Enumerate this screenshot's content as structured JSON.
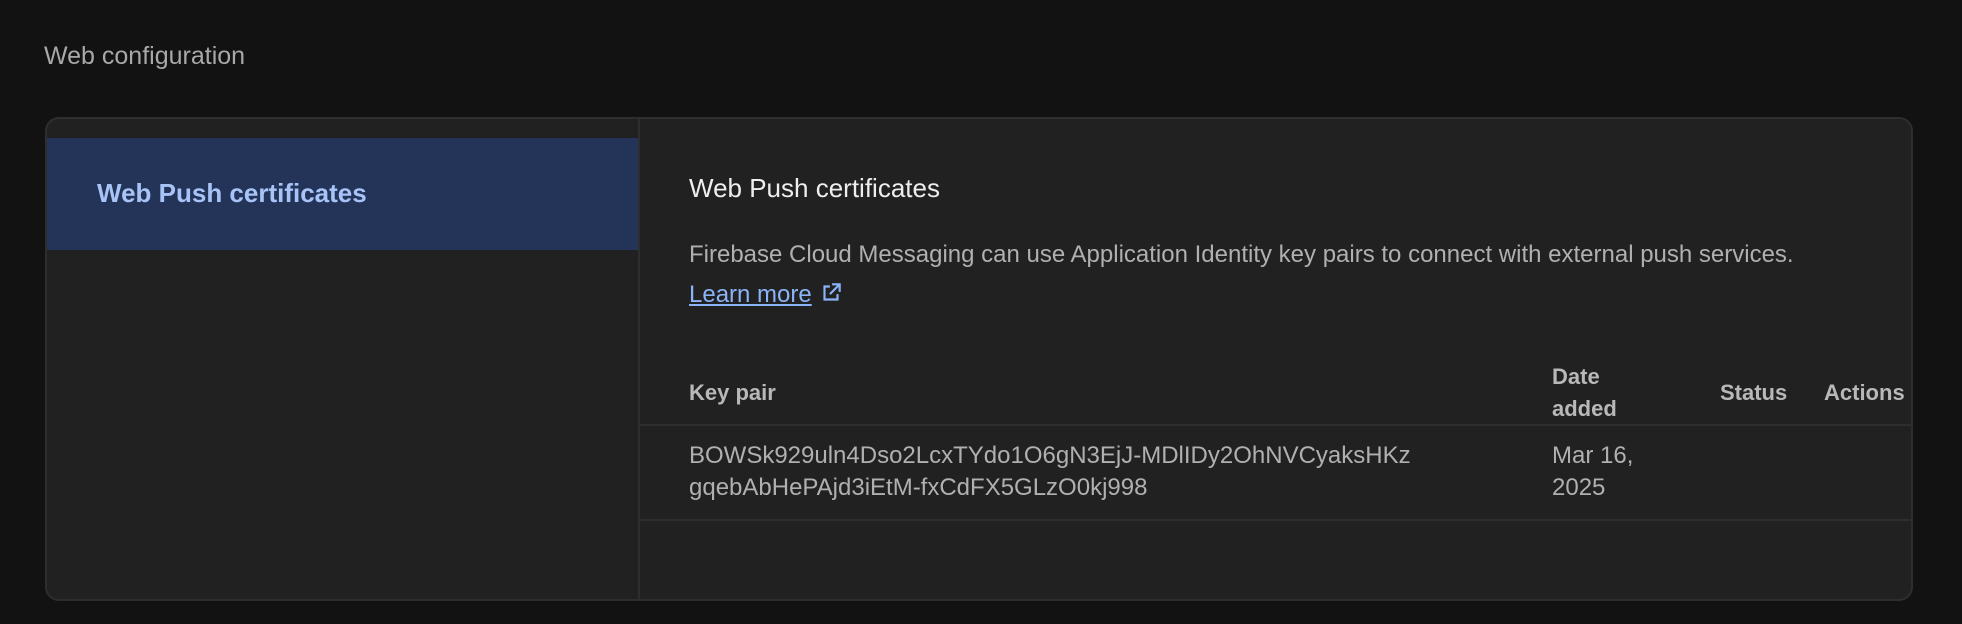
{
  "page": {
    "section_title": "Web configuration"
  },
  "sidebar": {
    "items": [
      {
        "label": "Web Push certificates"
      }
    ]
  },
  "content": {
    "title": "Web Push certificates",
    "description": "Firebase Cloud Messaging can use Application Identity key pairs to connect with external push services.",
    "learn_more": "Learn more",
    "table": {
      "headers": {
        "key_pair": "Key pair",
        "date_added_line1": "Date",
        "date_added_line2": "added",
        "status": "Status",
        "actions": "Actions"
      },
      "rows": [
        {
          "key_line1": "BOWSk929uln4Dso2LcxTYdo1O6gN3EjJ-MDlIDy2OhNVCyaksHKz",
          "key_line2": "gqebAbHePAjd3iEtM-fxCdFX5GLzO0kj998",
          "date_line1": "Mar 16,",
          "date_line2": "2025",
          "status": "",
          "actions": ""
        }
      ]
    }
  },
  "colors": {
    "background": "#121212",
    "card": "#212121",
    "sidebar_selected": "#243358",
    "accent": "#8ab4f8"
  },
  "icons": {
    "external_link": "open-in-new-icon"
  }
}
